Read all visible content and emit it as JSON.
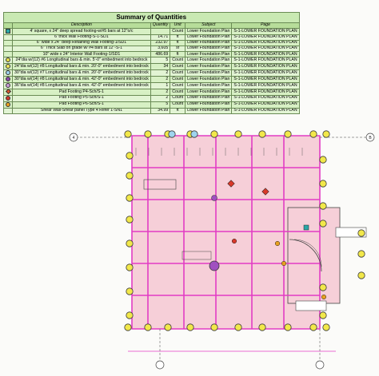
{
  "summary": {
    "title": "Summary of Quantities",
    "headers": [
      "Description",
      "Quantity",
      "Unit",
      "Subject",
      "Page"
    ],
    "rows": [
      {
        "icon": "square-marker-icon",
        "color": "#2aa7a7",
        "shape": "sq",
        "desc": "4' square, x 24\" deep spread footing-w/#5 bars at 12\"o/c",
        "qty": "",
        "unit": "Count",
        "subject": "Lower Foundation Plan",
        "page": "S-1-LOWER FOUNDATION PLAN"
      },
      {
        "icon": "",
        "color": "",
        "shape": "",
        "desc": "6' thick Wall Footing-S-1-SD1",
        "qty": "14.71",
        "unit": "ft",
        "subject": "Lower Foundation Plan",
        "page": "S-1-LOWER FOUNDATION PLAN"
      },
      {
        "icon": "",
        "color": "",
        "shape": "",
        "desc": "6\" wide x 24\" deep Retaining Wall Footing-1/SD1",
        "qty": "232.97",
        "unit": "ft",
        "subject": "Lower Foundation Plan",
        "page": "S-1-LOWER FOUNDATION PLAN"
      },
      {
        "icon": "",
        "color": "",
        "shape": "",
        "desc": "6\" Thick Slab on grade w/ #4 bars at 12\"-S-1",
        "qty": "3,605",
        "unit": "sf",
        "subject": "Lower Foundation Plan",
        "page": "S-1-LOWER FOUNDATION PLAN"
      },
      {
        "icon": "",
        "color": "",
        "shape": "",
        "desc": "10\" wide x 24\" Interior Wall Footing-1/SD1",
        "qty": "486.69",
        "unit": "ft",
        "subject": "Lower Foundation Plan",
        "page": "S-1-LOWER FOUNDATION PLAN"
      },
      {
        "icon": "circle-marker-icon",
        "color": "#e6e04a",
        "shape": "",
        "desc": "24\"dia w/(12) #6 Longitudinal bars & min. 5'-0\" embedment into bedrock",
        "qty": "5",
        "unit": "Count",
        "subject": "Lower Foundation Plan",
        "page": "S-1-LOWER FOUNDATION PLAN"
      },
      {
        "icon": "circle-marker-icon",
        "color": "#f0e85a",
        "shape": "",
        "desc": "24\"dia w/(12) #8 Longitudinal bars & min. 20'-0\" embedment into bedrock",
        "qty": "34",
        "unit": "Count",
        "subject": "Lower Foundation Plan",
        "page": "S-1-LOWER FOUNDATION PLAN"
      },
      {
        "icon": "circle-marker-icon",
        "color": "#9fd4ee",
        "shape": "",
        "desc": "30\"dia w/(12) #7 Longitudinal bars & min. 20'-0\" embedment into bedrock",
        "qty": "2",
        "unit": "Count",
        "subject": "Lower Foundation Plan",
        "page": "S-1-LOWER FOUNDATION PLAN"
      },
      {
        "icon": "circle-marker-icon",
        "color": "#8a4aa8",
        "shape": "",
        "desc": "30\"dia w/(14) #8 Longitudinal bars & min. 42'-0\" embedment into bedrock",
        "qty": "2",
        "unit": "Count",
        "subject": "Lower Foundation Plan",
        "page": "S-1-LOWER FOUNDATION PLAN"
      },
      {
        "icon": "circle-marker-icon",
        "color": "#c89ad6",
        "shape": "",
        "desc": "36\"dia w/(14) #8 Longitudinal bars & min. 42'-0\" embedment into bedrock",
        "qty": "1",
        "unit": "Count",
        "subject": "Lower Foundation Plan",
        "page": "S-1-LOWER FOUNDATION PLAN"
      },
      {
        "icon": "diamond-marker-icon",
        "color": "#e05a2a",
        "shape": "dm",
        "desc": "Pad Footing P4-Sch/S-1",
        "qty": "2",
        "unit": "Count",
        "subject": "Lower Foundation Plan",
        "page": "S-1-LOWER FOUNDATION PLAN"
      },
      {
        "icon": "circle-marker-icon",
        "color": "#d03a2a",
        "shape": "",
        "desc": "Pad Footing P5-Sch/S-1",
        "qty": "2",
        "unit": "Count",
        "subject": "Lower Foundation Plan",
        "page": "S-1-LOWER FOUNDATION PLAN"
      },
      {
        "icon": "circle-marker-icon",
        "color": "#e8a020",
        "shape": "",
        "desc": "Pad Footing P6-Sch/S-1",
        "qty": "5",
        "unit": "Count",
        "subject": "Lower Foundation Plan",
        "page": "S-1-LOWER FOUNDATION PLAN"
      },
      {
        "icon": "",
        "color": "",
        "shape": "",
        "desc": "Shear Wall-Shear panel Type 4 Refer 1-SN1",
        "qty": "34.99",
        "unit": "ft",
        "subject": "Lower Foundation Plan",
        "page": "S-1-LOWER FOUNDATION PLAN"
      }
    ]
  },
  "plan": {
    "grid_left": "4",
    "grid_right": "B",
    "colors": {
      "fill": "#f6cfd8",
      "wall": "#e23cc4",
      "pier": "#f2e84a",
      "pierDark": "#3a3a3a",
      "line": "#444444",
      "teal": "#2aa7a7",
      "red": "#d8382a",
      "orange": "#e8a020",
      "purple": "#a050c0"
    }
  }
}
